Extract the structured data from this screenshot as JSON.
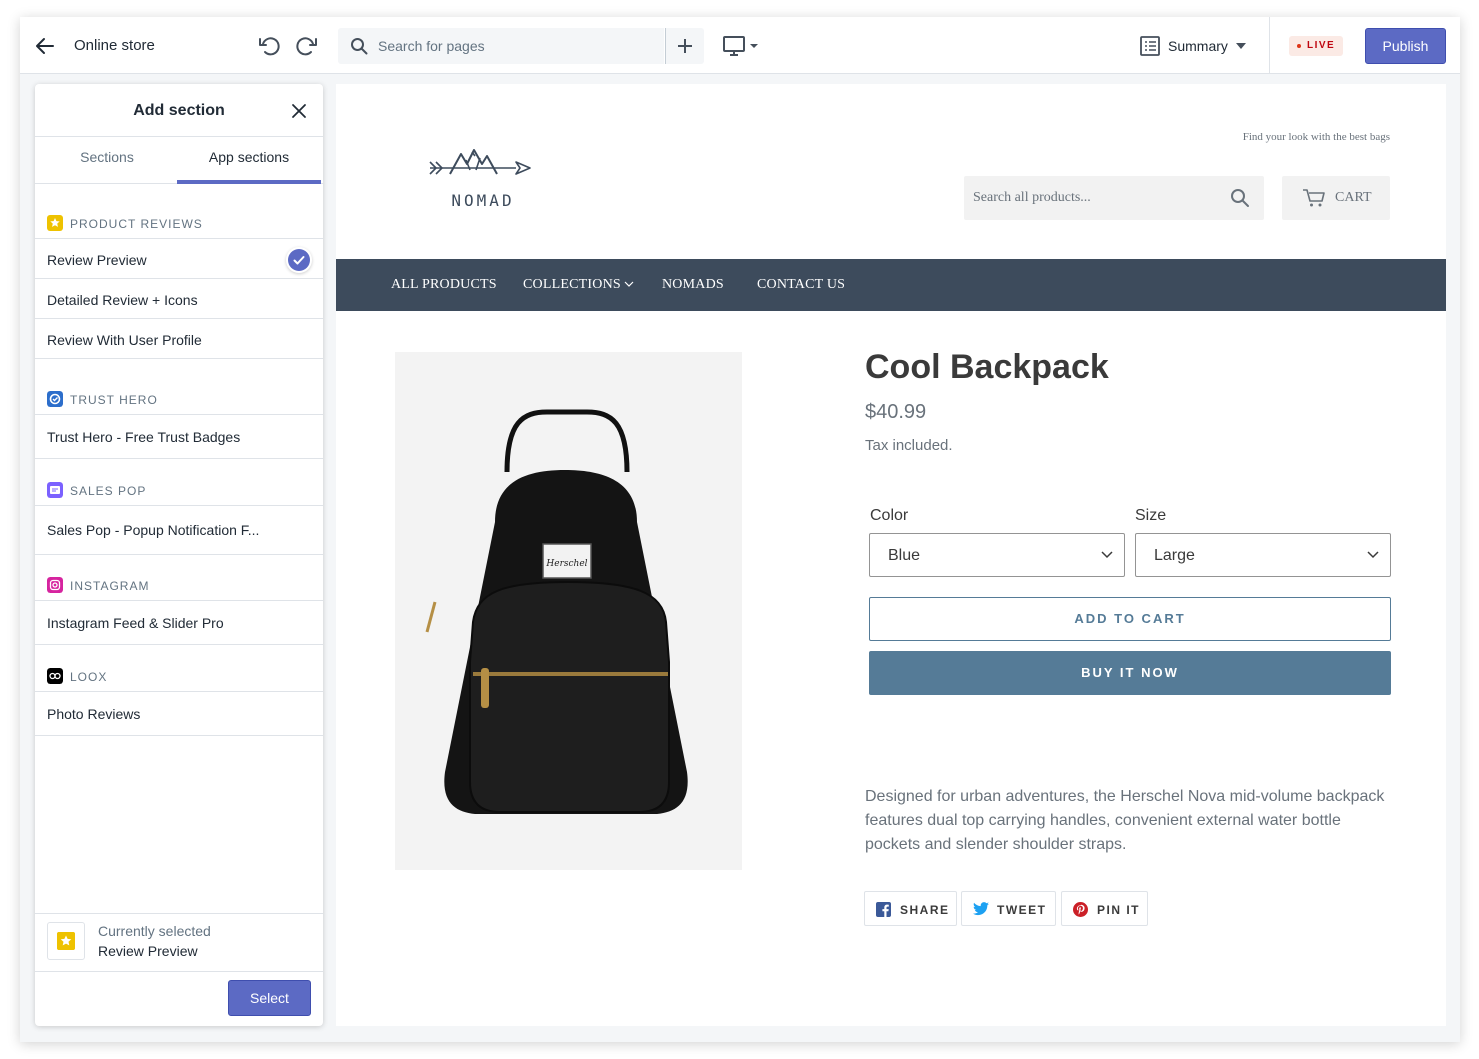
{
  "topbar": {
    "title": "Online store",
    "search_placeholder": "Search for pages",
    "summary_label": "Summary",
    "live_label": "LIVE",
    "publish_label": "Publish"
  },
  "panel": {
    "title": "Add section",
    "tabs": [
      {
        "label": "Sections",
        "active": false
      },
      {
        "label": "App sections",
        "active": true
      }
    ],
    "groups": [
      {
        "label": "PRODUCT REVIEWS",
        "icon": "star-icon",
        "color": "#eec200",
        "items": [
          "Review Preview",
          "Detailed Review + Icons",
          "Review With User Profile"
        ]
      },
      {
        "label": "TRUST HERO",
        "icon": "trust-hero-icon",
        "color": "#2c6ecb",
        "items": [
          "Trust Hero - Free Trust Badges"
        ]
      },
      {
        "label": "SALES POP",
        "icon": "sales-pop-icon",
        "color": "#7b61ff",
        "items": [
          "Sales Pop - Popup Notification F..."
        ]
      },
      {
        "label": "INSTAGRAM",
        "icon": "instagram-icon",
        "color": "#d6249f",
        "items": [
          "Instagram Feed & Slider Pro"
        ]
      },
      {
        "label": "LOOX",
        "icon": "loox-icon",
        "color": "#000000",
        "items": [
          "Photo Reviews"
        ]
      }
    ],
    "selected_item": "Review Preview",
    "footer": {
      "current_label": "Currently selected",
      "current_value": "Review Preview",
      "select_label": "Select"
    }
  },
  "store": {
    "logo_text": "NOMAD",
    "tagline": "Find your look with the best bags",
    "search_placeholder": "Search all products...",
    "cart_label": "CART",
    "nav": [
      "ALL PRODUCTS",
      "COLLECTIONS",
      "NOMADS",
      "CONTACT US"
    ],
    "product": {
      "title": "Cool Backpack",
      "price": "$40.99",
      "tax_note": "Tax included.",
      "color_label": "Color",
      "color_value": "Blue",
      "size_label": "Size",
      "size_value": "Large",
      "add_to_cart": "ADD TO CART",
      "buy_now": "BUY IT NOW",
      "description": "Designed for urban adventures, the Herschel Nova mid-volume backpack features dual top carrying handles, convenient external water bottle pockets and slender shoulder straps.",
      "image_label": "Herschel"
    },
    "share": [
      {
        "label": "SHARE",
        "icon": "facebook-icon",
        "color": "#3b5998"
      },
      {
        "label": "TWEET",
        "icon": "twitter-icon",
        "color": "#1da1f2"
      },
      {
        "label": "PIN IT",
        "icon": "pinterest-icon",
        "color": "#cb2027"
      }
    ]
  },
  "colors": {
    "accent": "#5c6ac4",
    "navbar": "#3d4b5c",
    "button": "#557b97"
  }
}
